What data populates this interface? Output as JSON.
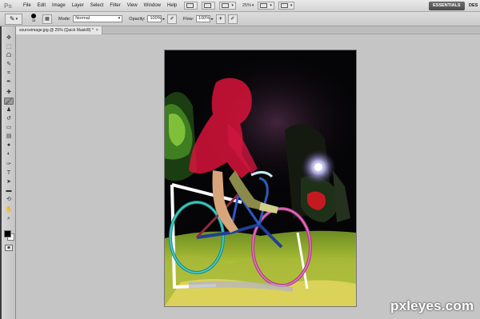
{
  "app": {
    "logo": "Ps",
    "menu": [
      "File",
      "Edit",
      "Image",
      "Layer",
      "Select",
      "Filter",
      "View",
      "Window",
      "Help"
    ],
    "zoom_level": "25%",
    "workspace": "ESSENTIALS",
    "workspace_next": "DES"
  },
  "options_bar": {
    "brush_size": "28",
    "mode_label": "Mode:",
    "mode_value": "Normal",
    "opacity_label": "Opacity:",
    "opacity_value": "100%",
    "flow_label": "Flow:",
    "flow_value": "100%"
  },
  "document": {
    "tab_title": "sourceimage.jpg @ 25% (Quick Mask/8) *",
    "tab_close": "×"
  },
  "toolbox": {
    "active_tool": "brush-tool",
    "foreground_color": "#000000",
    "background_color": "#ffffff",
    "tools": [
      {
        "name": "move-tool",
        "glyph": "✥"
      },
      {
        "name": "marquee-tool",
        "glyph": "⬚"
      },
      {
        "name": "lasso-tool",
        "glyph": "ᗝ"
      },
      {
        "name": "quick-select-tool",
        "glyph": "✎"
      },
      {
        "name": "crop-tool",
        "glyph": "⌗"
      },
      {
        "name": "eyedropper-tool",
        "glyph": "✒"
      },
      {
        "name": "healing-brush-tool",
        "glyph": "✚"
      },
      {
        "name": "brush-tool",
        "glyph": "🖌"
      },
      {
        "name": "clone-stamp-tool",
        "glyph": "♟"
      },
      {
        "name": "history-brush-tool",
        "glyph": "↺"
      },
      {
        "name": "eraser-tool",
        "glyph": "▭"
      },
      {
        "name": "gradient-tool",
        "glyph": "▤"
      },
      {
        "name": "blur-tool",
        "glyph": "●"
      },
      {
        "name": "dodge-tool",
        "glyph": "◐"
      },
      {
        "name": "pen-tool",
        "glyph": "✑"
      },
      {
        "name": "type-tool",
        "glyph": "T"
      },
      {
        "name": "path-select-tool",
        "glyph": "➤"
      },
      {
        "name": "shape-tool",
        "glyph": "▬"
      },
      {
        "name": "3d-rotate-tool",
        "glyph": "⟲"
      },
      {
        "name": "hand-tool",
        "glyph": "✋"
      },
      {
        "name": "zoom-tool",
        "glyph": "⌕"
      }
    ]
  },
  "watermark": "pxleyes.com"
}
